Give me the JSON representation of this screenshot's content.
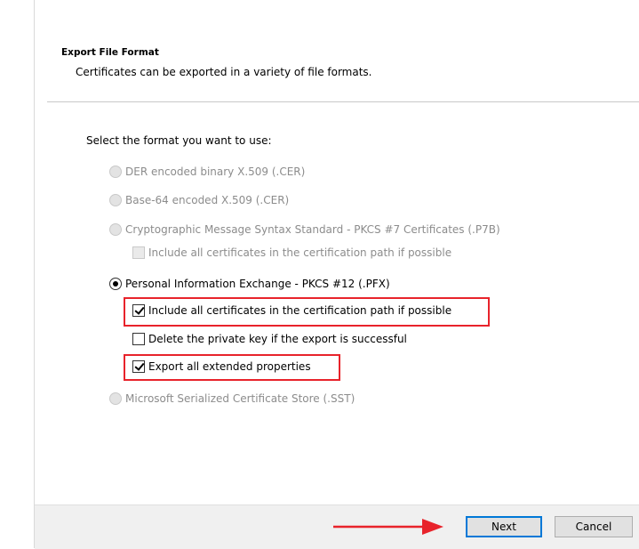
{
  "header": {
    "title": "Export File Format",
    "description": "Certificates can be exported in a variety of file formats."
  },
  "prompt": "Select the format you want to use:",
  "options": {
    "der": {
      "label": "DER encoded binary X.509 (.CER)",
      "enabled": false,
      "selected": false
    },
    "base64": {
      "label": "Base-64 encoded X.509 (.CER)",
      "enabled": false,
      "selected": false
    },
    "pkcs7": {
      "label": "Cryptographic Message Syntax Standard - PKCS #7 Certificates (.P7B)",
      "enabled": false,
      "selected": false
    },
    "pkcs7_include_all": {
      "label": "Include all certificates in the certification path if possible",
      "enabled": false,
      "checked": false
    },
    "pfx": {
      "label": "Personal Information Exchange - PKCS #12 (.PFX)",
      "enabled": true,
      "selected": true
    },
    "pfx_include_all": {
      "label": "Include all certificates in the certification path if possible",
      "enabled": true,
      "checked": true
    },
    "pfx_delete_key": {
      "label": "Delete the private key if the export is successful",
      "enabled": true,
      "checked": false
    },
    "pfx_export_ext": {
      "label": "Export all extended properties",
      "enabled": true,
      "checked": true
    },
    "sst": {
      "label": "Microsoft Serialized Certificate Store (.SST)",
      "enabled": false,
      "selected": false
    }
  },
  "buttons": {
    "next": "Next",
    "cancel": "Cancel"
  },
  "colors": {
    "highlight": "#e8232b",
    "arrow": "#e8232b",
    "default_button_border": "#0078d7"
  },
  "icons": {
    "annotation_arrow": "arrow-right-icon"
  }
}
